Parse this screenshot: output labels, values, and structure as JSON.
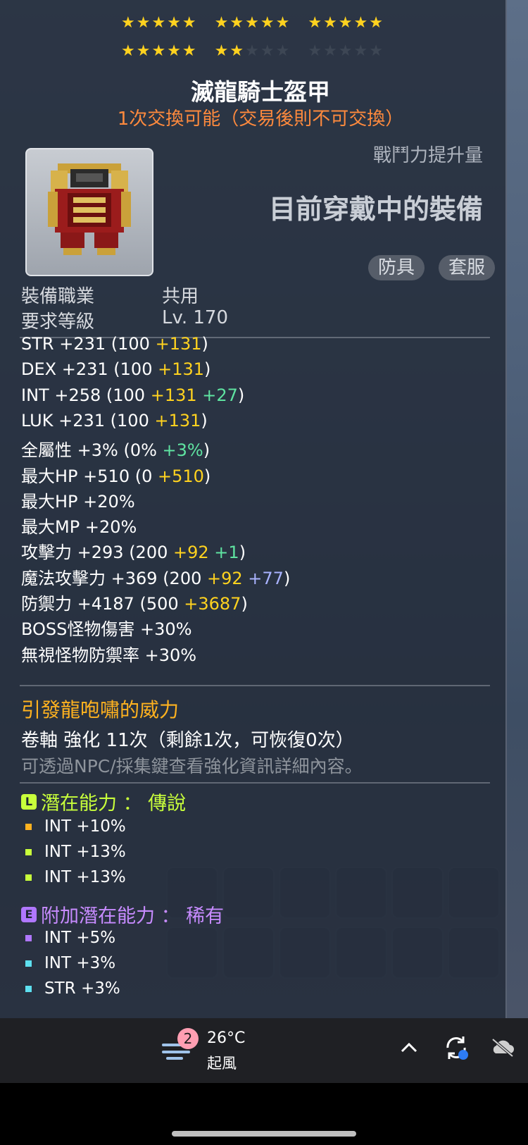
{
  "item": {
    "stars_rows": [
      [
        {
          "filled": 5,
          "empty": 0
        },
        {
          "filled": 5,
          "empty": 0
        },
        {
          "filled": 5,
          "empty": 0
        }
      ],
      [
        {
          "filled": 5,
          "empty": 0
        },
        {
          "filled": 2,
          "empty": 3
        },
        {
          "filled": 0,
          "empty": 5
        }
      ]
    ],
    "name": "滅龍騎士盔甲",
    "trade_note": "1次交換可能（交易後則不可交換）",
    "power_label": "戰鬥力提升量",
    "equipped_label": "目前穿戴中的裝備",
    "tags": [
      "防具",
      "套服"
    ],
    "requirements": [
      {
        "label": "裝備職業",
        "value": "共用"
      },
      {
        "label": "要求等級",
        "value": "Lv. 170"
      }
    ]
  },
  "stats": [
    {
      "name": "STR",
      "main": "+231",
      "paren_open": " (100 ",
      "bonus": "+131",
      "bonus2": "",
      "paren_close": ")"
    },
    {
      "name": "DEX",
      "main": "+231",
      "paren_open": " (100 ",
      "bonus": "+131",
      "bonus2": "",
      "paren_close": ")"
    },
    {
      "name": "INT",
      "main": "+258",
      "paren_open": " (100 ",
      "bonus": "+131",
      "bonus2": "+27",
      "paren_close": ")"
    },
    {
      "name": "LUK",
      "main": "+231",
      "paren_open": " (100 ",
      "bonus": "+131",
      "bonus2": "",
      "paren_close": ")"
    },
    {
      "name": "全屬性",
      "main": "+3%",
      "paren_open": " (0% ",
      "bonus": "",
      "bonus2": "+3%",
      "paren_close": ")"
    },
    {
      "name": "最大HP",
      "main": "+510",
      "paren_open": " (0 ",
      "bonus": "+510",
      "bonus2": "",
      "paren_close": ")"
    },
    {
      "name": "最大HP",
      "main": "+20%",
      "paren_open": "",
      "bonus": "",
      "bonus2": "",
      "paren_close": ""
    },
    {
      "name": "最大MP",
      "main": "+20%",
      "paren_open": "",
      "bonus": "",
      "bonus2": "",
      "paren_close": ""
    },
    {
      "name": "攻擊力",
      "main": "+293",
      "paren_open": " (200 ",
      "bonus": "+92",
      "bonus2": "+1",
      "paren_close": ")"
    },
    {
      "name": "魔法攻擊力",
      "main": "+369",
      "paren_open": " (200 ",
      "bonus": "+92",
      "bonus3": "+77",
      "paren_close": ")"
    },
    {
      "name": "防禦力",
      "main": "+4187",
      "paren_open": " (500 ",
      "bonus": "+3687",
      "bonus2": "",
      "paren_close": ")"
    },
    {
      "name": "BOSS怪物傷害",
      "main": "+30%",
      "paren_open": "",
      "bonus": "",
      "bonus2": "",
      "paren_close": ""
    },
    {
      "name": "無視怪物防禦率",
      "main": "+30%",
      "paren_open": "",
      "bonus": "",
      "bonus2": "",
      "paren_close": ""
    }
  ],
  "flavor_text": "引發龍咆嘯的威力",
  "upgrade_text": "卷軸 強化 11次（剩餘1次，可恢復0次）",
  "upgrade_hint": "可透過NPC/採集鍵查看強化資訊詳細內容。",
  "potential": {
    "badge": "L",
    "title": "潛在能力 ： 傳說",
    "lines": [
      "INT +10%",
      "INT +13%",
      "INT +13%"
    ],
    "bullet_colors": [
      "#ffb21f",
      "#c8ff3b",
      "#c8ff3b"
    ]
  },
  "additional_potential": {
    "badge": "E",
    "title": "附加潛在能力 ： 稀有",
    "lines": [
      "INT +5%",
      "INT +3%",
      "STR +3%"
    ],
    "bullet_colors": [
      "#b077ff",
      "#5ee0f0",
      "#5ee0f0"
    ]
  },
  "taskbar": {
    "weather_badge": "2",
    "temperature": "26°C",
    "condition": "起風"
  },
  "colors": {
    "star_on": "#ffd21f",
    "trade_note": "#ff8a3d",
    "bonus_yellow": "#ffd21f",
    "bonus_green": "#5fe3a1",
    "bonus_blue": "#a9b3ff",
    "legendary": "#c8ff3b",
    "rare": "#c78bff"
  }
}
